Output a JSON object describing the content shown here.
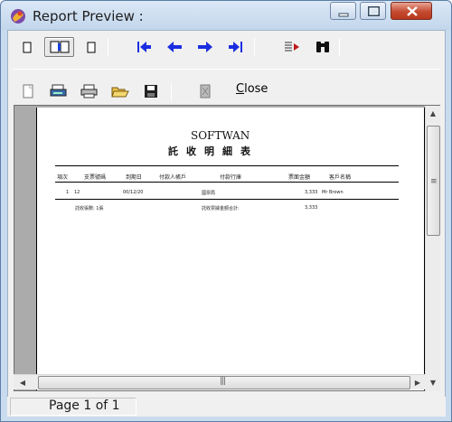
{
  "window": {
    "title": "Report Preview :"
  },
  "toolbar1": {
    "view_single": "single-page-view-icon",
    "view_facing": "facing-page-view-icon",
    "view_right": "right-page-view-icon",
    "nav": [
      "first-page-icon",
      "previous-page-icon",
      "next-page-icon",
      "last-page-icon"
    ],
    "goto": "goto-page-icon",
    "find": "binoculars-icon"
  },
  "toolbar2": {
    "close_label_rest": "lose",
    "close_label_mnemonic": "C"
  },
  "report": {
    "title": "SOFTWAN",
    "subtitle": "託收明細表",
    "headers": [
      "項次",
      "支票號碼",
      "到期日",
      "付款人帳戶",
      "付款行庫",
      "票面金額",
      "客戶名稱"
    ],
    "row": {
      "no": "1",
      "check": "12",
      "date": "00/12/20",
      "bank": "國票局",
      "amount": "3,333",
      "customer": "Mr Brown"
    },
    "footer": {
      "count": "託收張數: 1張",
      "total_label": "託收票據金額合計:",
      "total": "3,333"
    }
  },
  "status": {
    "page": "Page 1 of 1"
  }
}
